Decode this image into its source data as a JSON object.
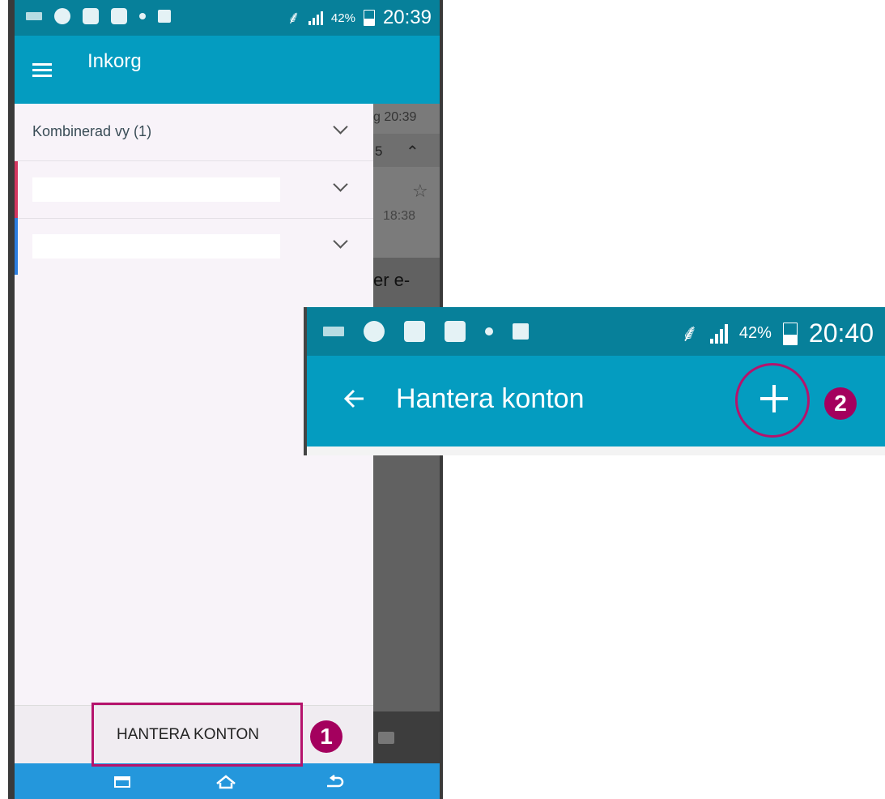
{
  "phone1": {
    "status_bar": {
      "battery_percent": "42%",
      "time": "20:39"
    },
    "app_bar": {
      "title": "Inkorg"
    },
    "background_content": {
      "time_top": "g 20:39",
      "count": "5",
      "time_item": "18:38",
      "snippet": "er e-"
    },
    "drawer": {
      "combined_view_label": "Kombinerad vy (1)",
      "accounts": [
        {
          "color": "#d3365f"
        },
        {
          "color": "#2b7de0"
        }
      ],
      "manage_accounts_button": "HANTERA KONTON"
    }
  },
  "phone2": {
    "status_bar": {
      "battery_percent": "42%",
      "time": "20:40"
    },
    "app_bar": {
      "title": "Hantera konton"
    }
  },
  "annotations": {
    "badge1": "1",
    "badge2": "2",
    "highlight_color": "#b5136c",
    "badge_color": "#a4005e"
  },
  "colors": {
    "status_bar": "#07809a",
    "app_bar": "#049cc0",
    "nav_bar": "#2497dc"
  }
}
